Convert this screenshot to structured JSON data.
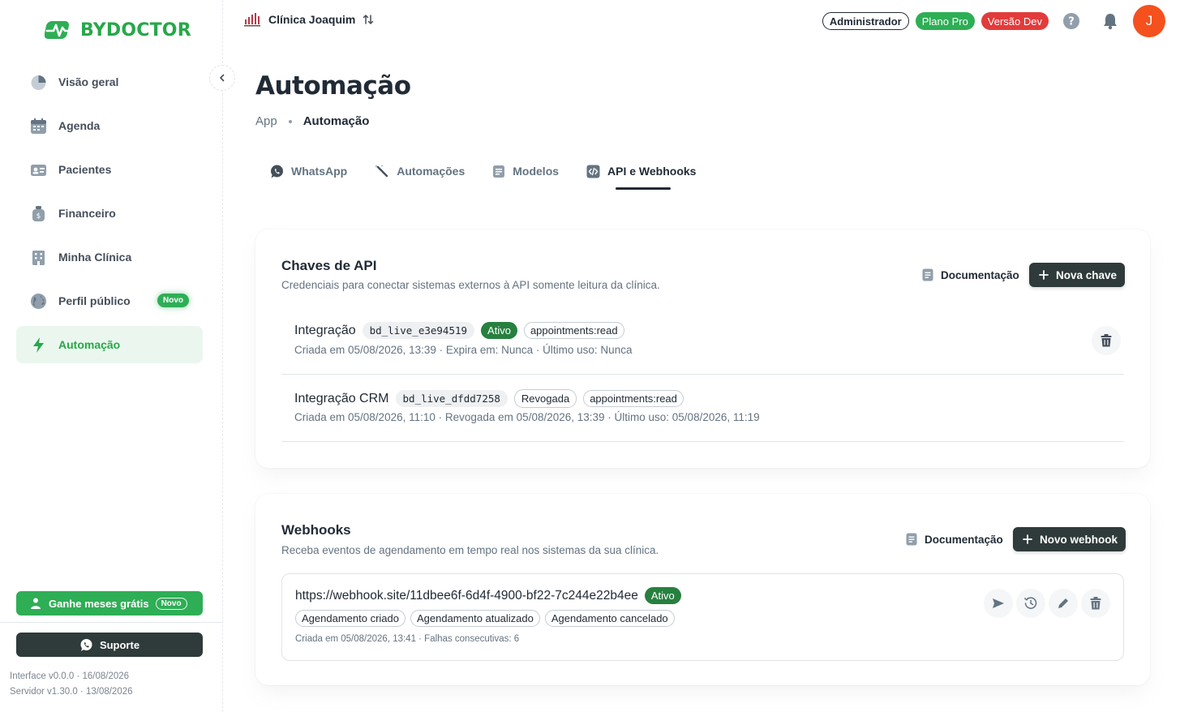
{
  "brand": {
    "name": "BYDOCTOR",
    "color": "#27a84a"
  },
  "sidebar": {
    "items": [
      {
        "label": "Visão geral",
        "icon": "pie-chart-icon"
      },
      {
        "label": "Agenda",
        "icon": "calendar-icon"
      },
      {
        "label": "Pacientes",
        "icon": "id-card-icon"
      },
      {
        "label": "Financeiro",
        "icon": "money-bag-icon"
      },
      {
        "label": "Minha Clínica",
        "icon": "building-icon"
      },
      {
        "label": "Perfil público",
        "icon": "globe-icon",
        "badge": "Novo"
      },
      {
        "label": "Automação",
        "icon": "lightning-icon",
        "active": true
      }
    ],
    "promo": {
      "label": "Ganhe meses grátis",
      "badge": "Novo"
    },
    "support_label": "Suporte",
    "version_interface": "Interface v0.0.0 · 16/08/2026",
    "version_server": "Servidor v1.30.0 · 13/08/2026"
  },
  "topbar": {
    "clinic_name": "Clínica Joaquim",
    "role": "Administrador",
    "plan": "Plano Pro",
    "env": "Versão Dev",
    "avatar_initial": "J"
  },
  "page": {
    "title": "Automação",
    "breadcrumb": [
      "App",
      "Automação"
    ]
  },
  "tabs": [
    {
      "label": "WhatsApp",
      "icon": "whatsapp-icon"
    },
    {
      "label": "Automações",
      "icon": "magic-wand-icon"
    },
    {
      "label": "Modelos",
      "icon": "document-icon"
    },
    {
      "label": "API e Webhooks",
      "icon": "code-icon",
      "active": true
    }
  ],
  "api_keys": {
    "title": "Chaves de API",
    "subtitle": "Credenciais para conectar sistemas externos à API somente leitura da clínica.",
    "doc_label": "Documentação",
    "new_label": "Nova chave",
    "keys": [
      {
        "name": "Integração",
        "prefix": "bd_live_e3e94519",
        "status": "Ativo",
        "scope": "appointments:read",
        "meta": "Criada em 05/08/2026, 13:39 · Expira em: Nunca · Último uso: Nunca"
      },
      {
        "name": "Integração CRM",
        "prefix": "bd_live_dfdd7258",
        "status": "Revogada",
        "scope": "appointments:read",
        "meta": "Criada em 05/08/2026, 11:10 · Revogada em 05/08/2026, 13:39 · Último uso: 05/08/2026, 11:19"
      }
    ]
  },
  "webhooks": {
    "title": "Webhooks",
    "subtitle": "Receba eventos de agendamento em tempo real nos sistemas da sua clínica.",
    "doc_label": "Documentação",
    "new_label": "Novo webhook",
    "items": [
      {
        "url": "https://webhook.site/11dbee6f-6d4f-4900-bf22-7c244e22b4ee",
        "status": "Ativo",
        "events": [
          "Agendamento criado",
          "Agendamento atualizado",
          "Agendamento cancelado"
        ],
        "meta": "Criada em 05/08/2026, 13:41 · Falhas consecutivas: 6"
      }
    ]
  }
}
